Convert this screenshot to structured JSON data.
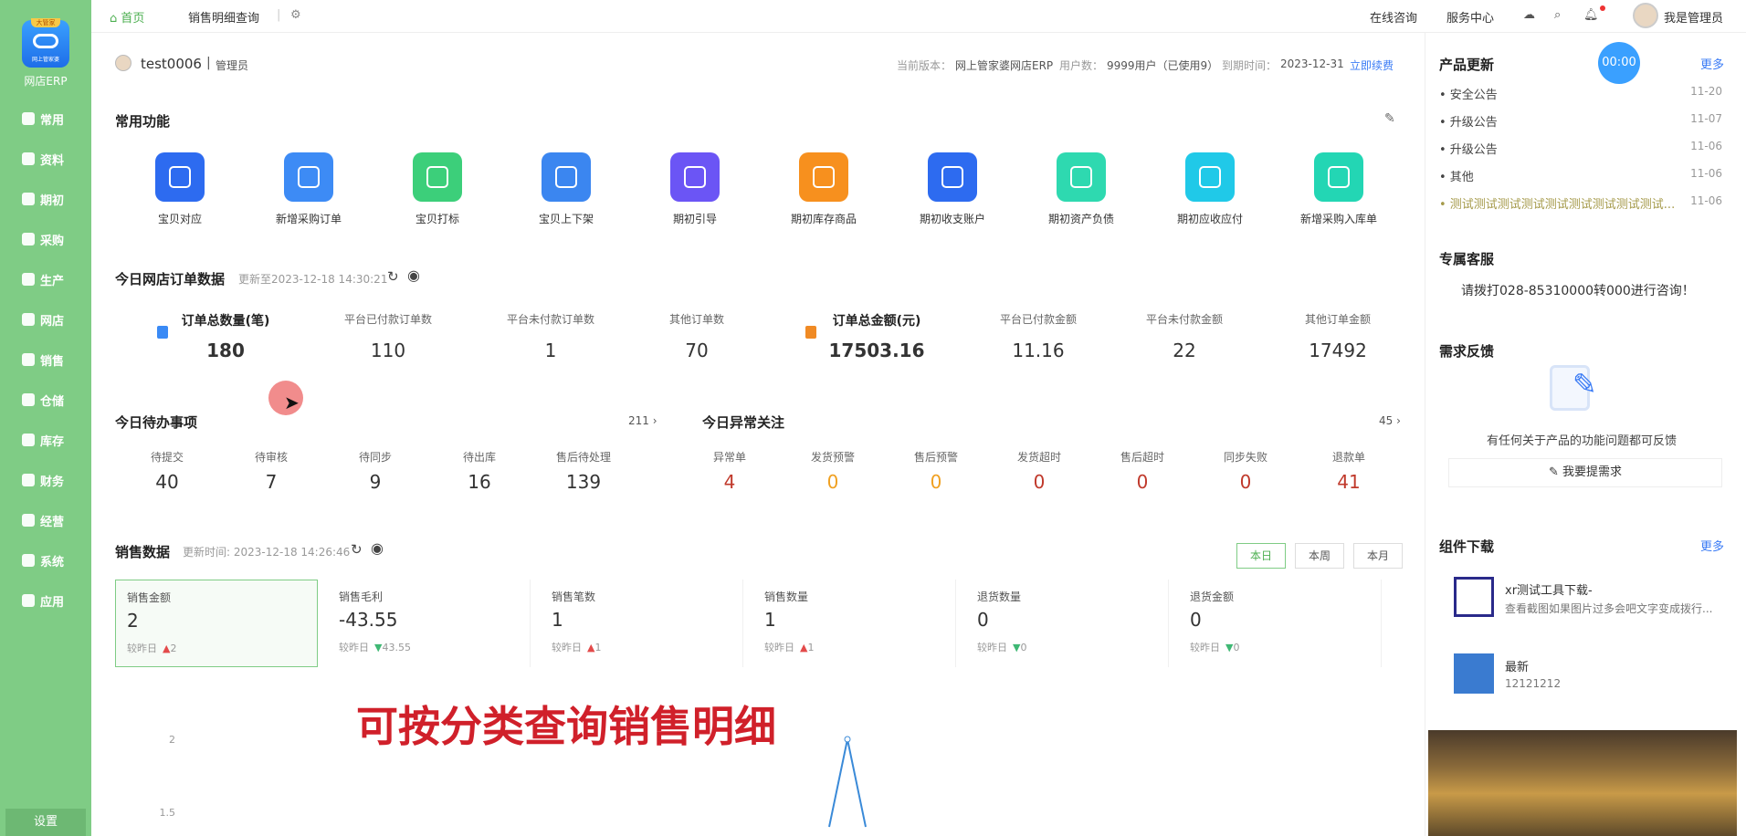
{
  "sidebar": {
    "brand": "网店ERP",
    "logo_tag": "大管家",
    "logo_sub": "网上管家婆",
    "items": [
      {
        "label": "常用"
      },
      {
        "label": "资料"
      },
      {
        "label": "期初"
      },
      {
        "label": "采购"
      },
      {
        "label": "生产"
      },
      {
        "label": "网店"
      },
      {
        "label": "销售"
      },
      {
        "label": "仓储"
      },
      {
        "label": "库存"
      },
      {
        "label": "财务"
      },
      {
        "label": "经营"
      },
      {
        "label": "系统"
      },
      {
        "label": "应用"
      }
    ],
    "settings": "设置"
  },
  "topbar": {
    "tab_home": "首页",
    "tab_sales_detail": "销售明细查询",
    "online_consult": "在线咨询",
    "service_center": "服务中心",
    "user": "我是管理员"
  },
  "userbar": {
    "account": "test0006",
    "role": "管理员",
    "version_label": "当前版本：",
    "version": "网上管家婆网店ERP",
    "users_label": "用户数：",
    "users": "9999用户（已使用9）",
    "expire_label": "到期时间：",
    "expire": "2023-12-31",
    "renew": "立即续费"
  },
  "common_functions": {
    "title": "常用功能",
    "items": [
      {
        "label": "宝贝对应",
        "color": "#2d6bf0"
      },
      {
        "label": "新增采购订单",
        "color": "#3d8bf5"
      },
      {
        "label": "宝贝打标",
        "color": "#3ccf7a"
      },
      {
        "label": "宝贝上下架",
        "color": "#3b86f0"
      },
      {
        "label": "期初引导",
        "color": "#6b55f5"
      },
      {
        "label": "期初库存商品",
        "color": "#f7901e"
      },
      {
        "label": "期初收支账户",
        "color": "#2d6bf0"
      },
      {
        "label": "期初资产负债",
        "color": "#2ed9b0"
      },
      {
        "label": "期初应收应付",
        "color": "#20c9e8"
      },
      {
        "label": "新增采购入库单",
        "color": "#23d6b4"
      }
    ]
  },
  "order_data": {
    "title": "今日网店订单数据",
    "updated": "更新至2023-12-18 14:30:21",
    "stats": [
      {
        "label": "订单总数量(笔)",
        "value": "180"
      },
      {
        "label": "平台已付款订单数",
        "value": "110"
      },
      {
        "label": "平台未付款订单数",
        "value": "1"
      },
      {
        "label": "其他订单数",
        "value": "70"
      },
      {
        "label": "订单总金额(元)",
        "value": "17503.16"
      },
      {
        "label": "平台已付款金额",
        "value": "11.16"
      },
      {
        "label": "平台未付款金额",
        "value": "22"
      },
      {
        "label": "其他订单金额",
        "value": "17492"
      }
    ]
  },
  "todo": {
    "title": "今日待办事项",
    "count": "211",
    "items": [
      {
        "label": "待提交",
        "value": "40"
      },
      {
        "label": "待审核",
        "value": "7"
      },
      {
        "label": "待同步",
        "value": "9"
      },
      {
        "label": "待出库",
        "value": "16"
      },
      {
        "label": "售后待处理",
        "value": "139"
      }
    ]
  },
  "abnormal": {
    "title": "今日异常关注",
    "count": "45",
    "items": [
      {
        "label": "异常单",
        "value": "4",
        "color": "#c0392b"
      },
      {
        "label": "发货预警",
        "value": "0",
        "color": "#f0a020"
      },
      {
        "label": "售后预警",
        "value": "0",
        "color": "#f0a020"
      },
      {
        "label": "发货超时",
        "value": "0",
        "color": "#c0392b"
      },
      {
        "label": "售后超时",
        "value": "0",
        "color": "#c0392b"
      },
      {
        "label": "同步失败",
        "value": "0",
        "color": "#c0392b"
      },
      {
        "label": "退款单",
        "value": "41",
        "color": "#c0392b"
      }
    ]
  },
  "sales": {
    "title": "销售数据",
    "updated": "更新时间: 2023-12-18 14:26:46",
    "period_buttons": [
      "本日",
      "本周",
      "本月"
    ],
    "compare_label": "较昨日",
    "boxes": [
      {
        "label": "销售金额",
        "value": "2",
        "delta": "2",
        "dir": "up"
      },
      {
        "label": "销售毛利",
        "value": "-43.55",
        "delta": "43.55",
        "dir": "down"
      },
      {
        "label": "销售笔数",
        "value": "1",
        "delta": "1",
        "dir": "up"
      },
      {
        "label": "销售数量",
        "value": "1",
        "delta": "1",
        "dir": "up"
      },
      {
        "label": "退货数量",
        "value": "0",
        "delta": "0",
        "dir": "down"
      },
      {
        "label": "退货金额",
        "value": "0",
        "delta": "0",
        "dir": "down"
      }
    ],
    "overlay_text": "可按分类查询销售明细"
  },
  "chart_data": {
    "type": "line",
    "title": "",
    "xlabel": "",
    "ylabel": "",
    "y_ticks": [
      "2",
      "1.5"
    ],
    "ylim": [
      1.5,
      2
    ],
    "points": [
      {
        "x": 0,
        "y": 1.4
      },
      {
        "x": 1,
        "y": 2
      },
      {
        "x": 2,
        "y": 1.4
      }
    ]
  },
  "right_panel": {
    "product_updates_title": "产品更新",
    "more": "更多",
    "timer": "00:00",
    "updates": [
      {
        "label": "• 安全公告",
        "date": "11-20"
      },
      {
        "label": "• 升级公告",
        "date": "11-07"
      },
      {
        "label": "• 升级公告",
        "date": "11-06"
      },
      {
        "label": "• 其他",
        "date": "11-06"
      },
      {
        "label": "• 测试测试测试测试测试测试测试测试测试...",
        "date": "11-06"
      }
    ],
    "service_title": "专属客服",
    "service_text": "请拨打028-85310000转000进行咨询！",
    "feedback_title": "需求反馈",
    "feedback_text": "有任何关于产品的功能问题都可反馈",
    "feedback_button": "我要提需求",
    "download_title": "组件下载",
    "downloads": [
      {
        "name": "xr测试工具下载-",
        "desc": "查看截图如果图片过多会吧文字变成拨行..."
      },
      {
        "name": "最新",
        "desc": "12121212"
      }
    ]
  }
}
